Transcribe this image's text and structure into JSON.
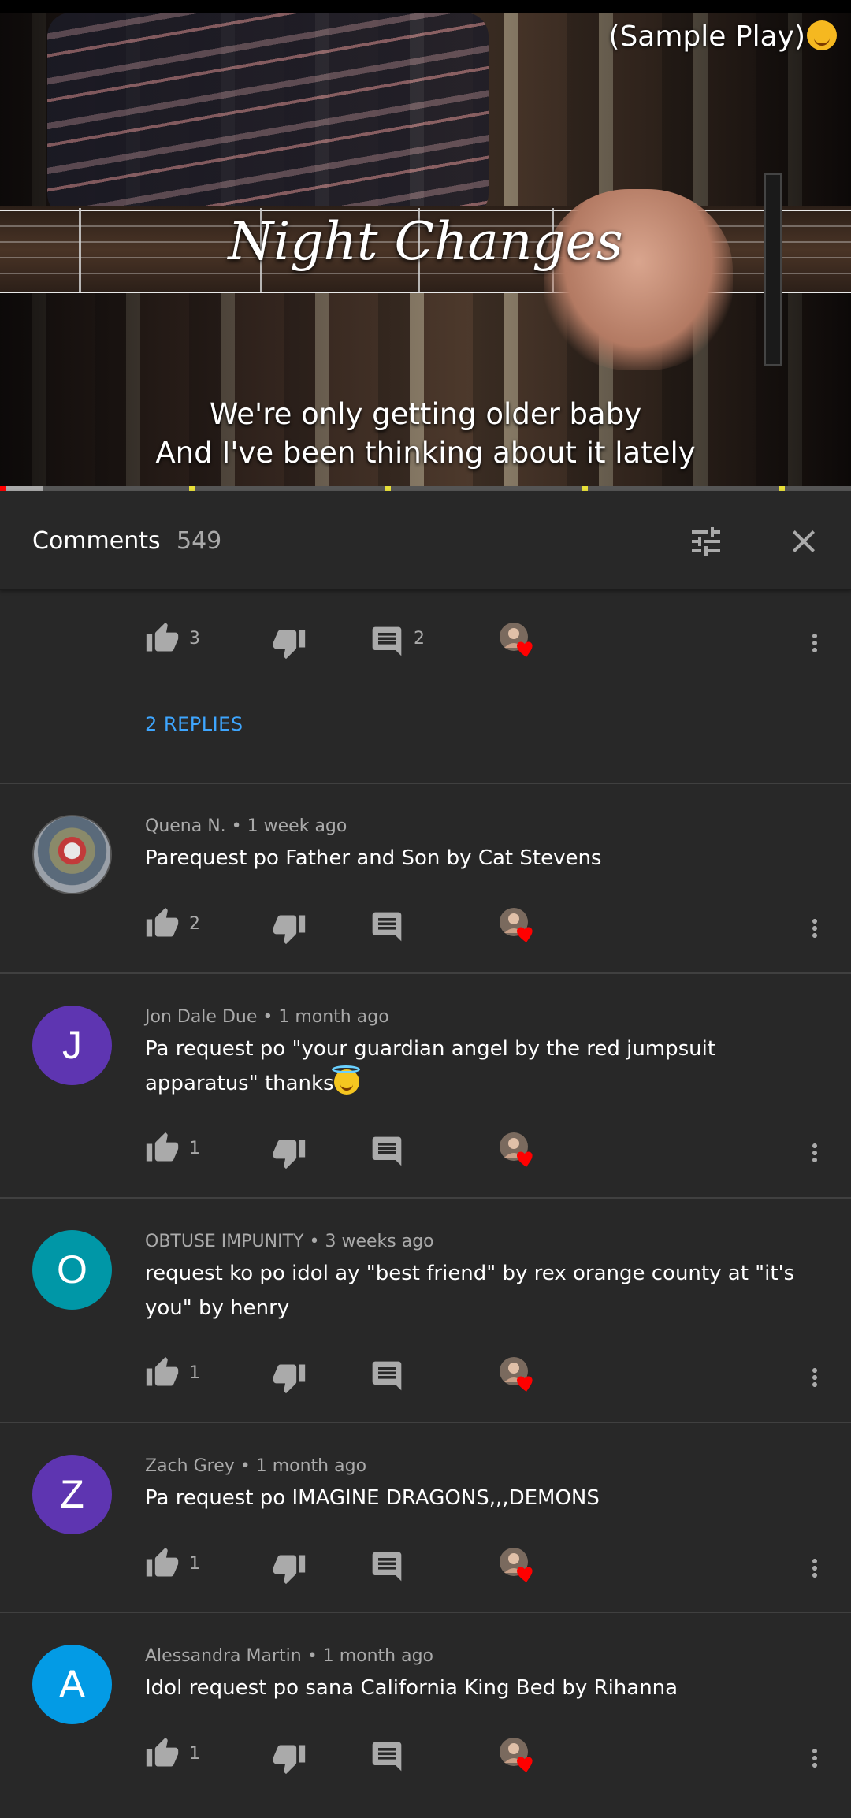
{
  "video": {
    "title_overlay": "Night Changes",
    "sample_label": "(Sample Play)",
    "caption_line1": "We're only getting older baby",
    "caption_line2": "And I've been thinking about it lately",
    "progress_played_fraction": 0.0074,
    "progress_buffered_fraction": 0.0426
  },
  "header": {
    "title": "Comments",
    "count": "549",
    "filter_icon": "tune-icon",
    "close_icon": "close-icon"
  },
  "thread_top": {
    "like_count": "3",
    "reply_count": "2",
    "replies_link": "2 REPLIES"
  },
  "comments": [
    {
      "author": "Quena N.",
      "time": "1 week ago",
      "text": "Parequest po Father and Son by Cat Stevens",
      "like_count": "2",
      "avatar_letter": "",
      "avatar_color": "#8a8a8a"
    },
    {
      "author": "Jon Dale Due",
      "time": "1 month ago",
      "text": "Pa request po \"your guardian angel by the red jumpsuit apparatus\" thanks",
      "like_count": "1",
      "avatar_letter": "J",
      "avatar_color": "#5e35b1"
    },
    {
      "author": "OBTUSE IMPUNITY",
      "time": "3 weeks ago",
      "text": "request ko po idol ay \"best friend\" by rex orange county at \"it's you\" by henry",
      "like_count": "1",
      "avatar_letter": "O",
      "avatar_color": "#0097a7"
    },
    {
      "author": "Zach Grey",
      "time": "1 month ago",
      "text": "Pa request po IMAGINE DRAGONS,,,DEMONS",
      "like_count": "1",
      "avatar_letter": "Z",
      "avatar_color": "#5e35b1"
    },
    {
      "author": "Alessandra Martin",
      "time": "1 month ago",
      "text": "Idol request po sana California King Bed by Rihanna",
      "like_count": "1",
      "avatar_letter": "A",
      "avatar_color": "#039be5"
    }
  ],
  "icons": {
    "like": "thumb-up-icon",
    "dislike": "thumb-down-icon",
    "reply": "reply-comment-icon",
    "creator_heart": "creator-heart-icon",
    "more": "more-vert-icon"
  },
  "meta_separator": "•"
}
